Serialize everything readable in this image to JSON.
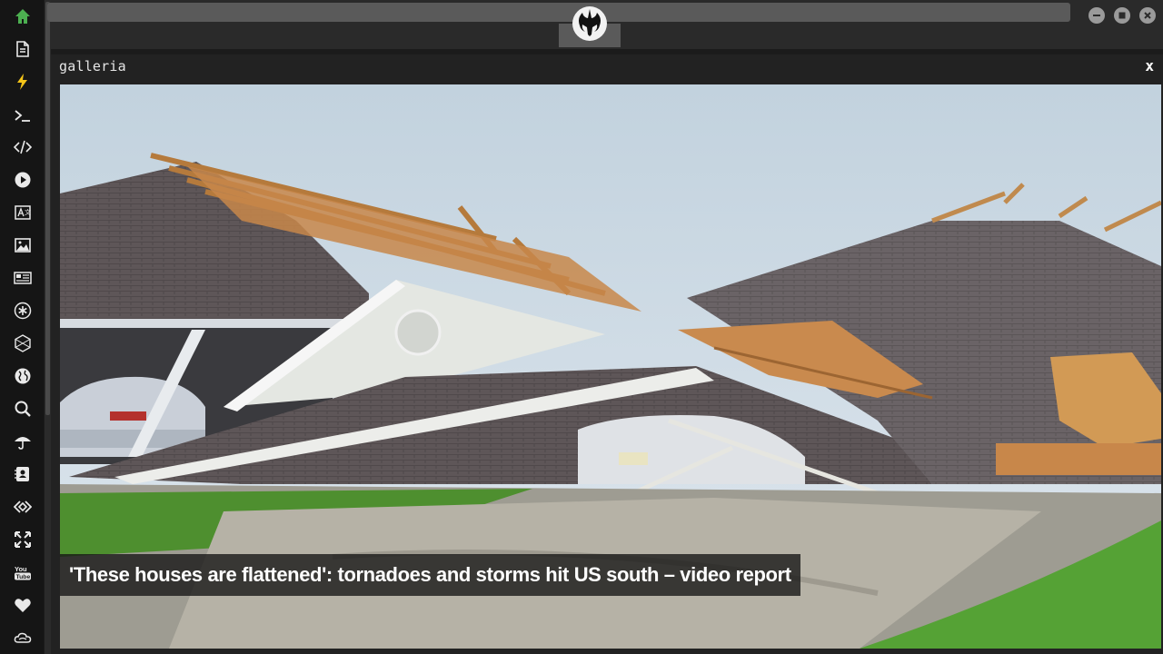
{
  "sidebar": {
    "items": [
      {
        "name": "home-icon",
        "color": "#4caf50"
      },
      {
        "name": "document-icon"
      },
      {
        "name": "lightning-icon",
        "color": "#f5c518"
      },
      {
        "name": "terminal-icon"
      },
      {
        "name": "code-icon"
      },
      {
        "name": "play-icon"
      },
      {
        "name": "translate-icon"
      },
      {
        "name": "image-icon"
      },
      {
        "name": "news-icon"
      },
      {
        "name": "asterisk-icon"
      },
      {
        "name": "hexagon-icon"
      },
      {
        "name": "globe-icon"
      },
      {
        "name": "search-icon"
      },
      {
        "name": "umbrella-icon"
      },
      {
        "name": "contact-icon"
      },
      {
        "name": "link-icon"
      },
      {
        "name": "expand-icon"
      },
      {
        "name": "youtube-icon"
      },
      {
        "name": "heart-icon"
      },
      {
        "name": "cloud-icon"
      }
    ]
  },
  "topbar": {
    "logo": "rebel-alliance-icon",
    "window_controls": [
      "minimize",
      "maximize",
      "close"
    ]
  },
  "galleria": {
    "title": "galleria",
    "close_label": "x",
    "caption": "'These houses are flattened': tornadoes and storms hit US south – video report"
  }
}
